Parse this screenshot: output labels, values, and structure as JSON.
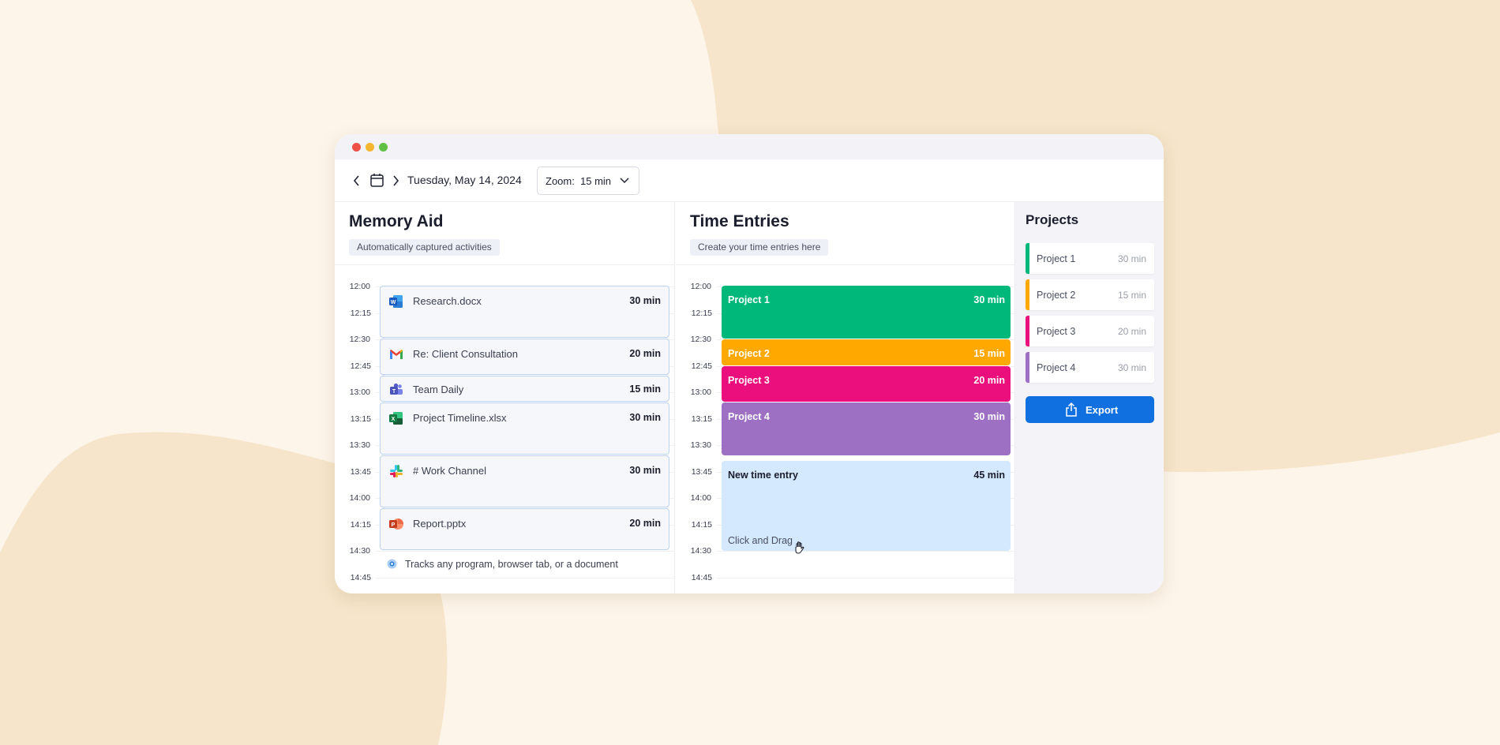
{
  "toolbar": {
    "date": "Tuesday, May 14, 2024",
    "zoom_label": "Zoom:",
    "zoom_value": "15 min"
  },
  "memory": {
    "title": "Memory Aid",
    "subtitle": "Automatically captured activities",
    "ticks": [
      "12:00",
      "12:15",
      "12:30",
      "12:45",
      "13:00",
      "13:15",
      "13:30",
      "13:45",
      "14:00",
      "14:15",
      "14:30",
      "14:45"
    ],
    "items": [
      {
        "name": "Research.docx",
        "duration": "30 min",
        "icon": "word-icon"
      },
      {
        "name": "Re: Client Consultation",
        "duration": "20 min",
        "icon": "gmail-icon"
      },
      {
        "name": "Team Daily",
        "duration": "15 min",
        "icon": "teams-icon"
      },
      {
        "name": "Project Timeline.xlsx",
        "duration": "30 min",
        "icon": "excel-icon"
      },
      {
        "name": "# Work Channel",
        "duration": "30 min",
        "icon": "slack-icon"
      },
      {
        "name": "Report.pptx",
        "duration": "20 min",
        "icon": "powerpoint-icon"
      }
    ],
    "footer": "Tracks any program, browser tab, or a document"
  },
  "time_entries": {
    "title": "Time Entries",
    "subtitle": "Create your time entries here",
    "ticks": [
      "12:00",
      "12:15",
      "12:30",
      "12:45",
      "13:00",
      "13:15",
      "13:30",
      "13:45",
      "14:00",
      "14:15",
      "14:30",
      "14:45"
    ],
    "entries": [
      {
        "name": "Project 1",
        "duration": "30 min",
        "color": "#00b87a"
      },
      {
        "name": "Project 2",
        "duration": "15 min",
        "color": "#ffa800"
      },
      {
        "name": "Project 3",
        "duration": "20 min",
        "color": "#ea0f7c"
      },
      {
        "name": "Project 4",
        "duration": "30 min",
        "color": "#9e70c4"
      }
    ],
    "new_entry": {
      "name": "New time entry",
      "duration": "45 min",
      "hint": "Click and Drag",
      "color": "#d4e9fd"
    }
  },
  "projects": {
    "title": "Projects",
    "items": [
      {
        "name": "Project 1",
        "duration": "30 min",
        "color": "#00b87a"
      },
      {
        "name": "Project 2",
        "duration": "15 min",
        "color": "#ffa800"
      },
      {
        "name": "Project 3",
        "duration": "20 min",
        "color": "#ea0f7c"
      },
      {
        "name": "Project 4",
        "duration": "30 min",
        "color": "#9e70c4"
      }
    ],
    "export_label": "Export",
    "export_color": "#1070e0"
  },
  "colors": {
    "background": "#fdf5ea",
    "blob": "#f6e5ca"
  }
}
